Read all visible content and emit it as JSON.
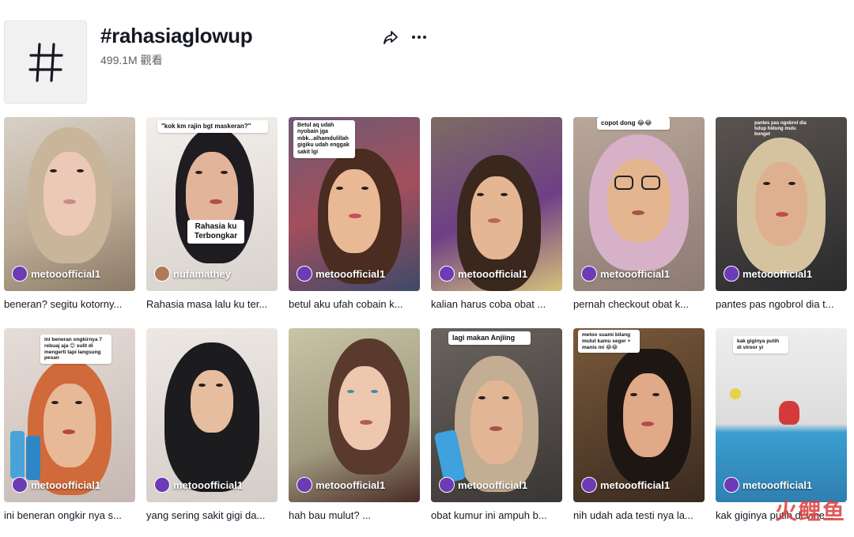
{
  "header": {
    "hashtag_symbol": "#",
    "title": "#rahasiaglowup",
    "views": "499.1M 觀看",
    "share_icon": "share-icon",
    "more_icon": "more-dots-icon"
  },
  "videos": [
    {
      "user": "metooofficial1",
      "caption": "beneran? segitu kotorny...",
      "bubble": ""
    },
    {
      "user": "nufamathey",
      "caption": "Rahasia masa lalu ku ter...",
      "bubble": "\"kok km rajin bgt maskeran?\"",
      "sticker": "Rahasia ku Terbongkar"
    },
    {
      "user": "metooofficial1",
      "caption": "betul aku ufah cobain k...",
      "bubble": "Betul aq udah nyobain jga mbk...alhamdulillah gigiku udah enggak sakit lgi"
    },
    {
      "user": "metooofficial1",
      "caption": "kalian harus coba obat ...",
      "bubble": ""
    },
    {
      "user": "metooofficial1",
      "caption": "pernah checkout obat k...",
      "bubble": "copot dong 😂😂"
    },
    {
      "user": "metooofficial1",
      "caption": "pantes pas ngobrol dia t...",
      "bubble": "pantes pas ngobrol dia tutup hidung mulu bonget"
    },
    {
      "user": "metooofficial1",
      "caption": "ini beneran ongkir nya s...",
      "bubble": "ini beneran ongkirnya 7 rebuaj aja 😊 sulit di mengerti tapi langsung pesan"
    },
    {
      "user": "metooofficial1",
      "caption": "yang sering sakit gigi da...",
      "bubble": ""
    },
    {
      "user": "metooofficial1",
      "caption": "hah bau mulut? ...",
      "bubble": ""
    },
    {
      "user": "metooofficial1",
      "caption": "obat kumur ini ampuh b...",
      "bubble": "lagi makan Anjiing"
    },
    {
      "user": "metooofficial1",
      "caption": "nih udah ada testi nya la...",
      "bubble": "metoo suami bilang mulut kamu seger + manis mi 😂😂"
    },
    {
      "user": "metooofficial1",
      "caption": "kak giginya putih di vine...",
      "bubble": "kak giginya putih di viroor yi"
    }
  ],
  "watermark": "火鲤鱼",
  "colors": {
    "text": "#161823",
    "muted": "#5f6065",
    "avatar": "#6c3bb5"
  }
}
